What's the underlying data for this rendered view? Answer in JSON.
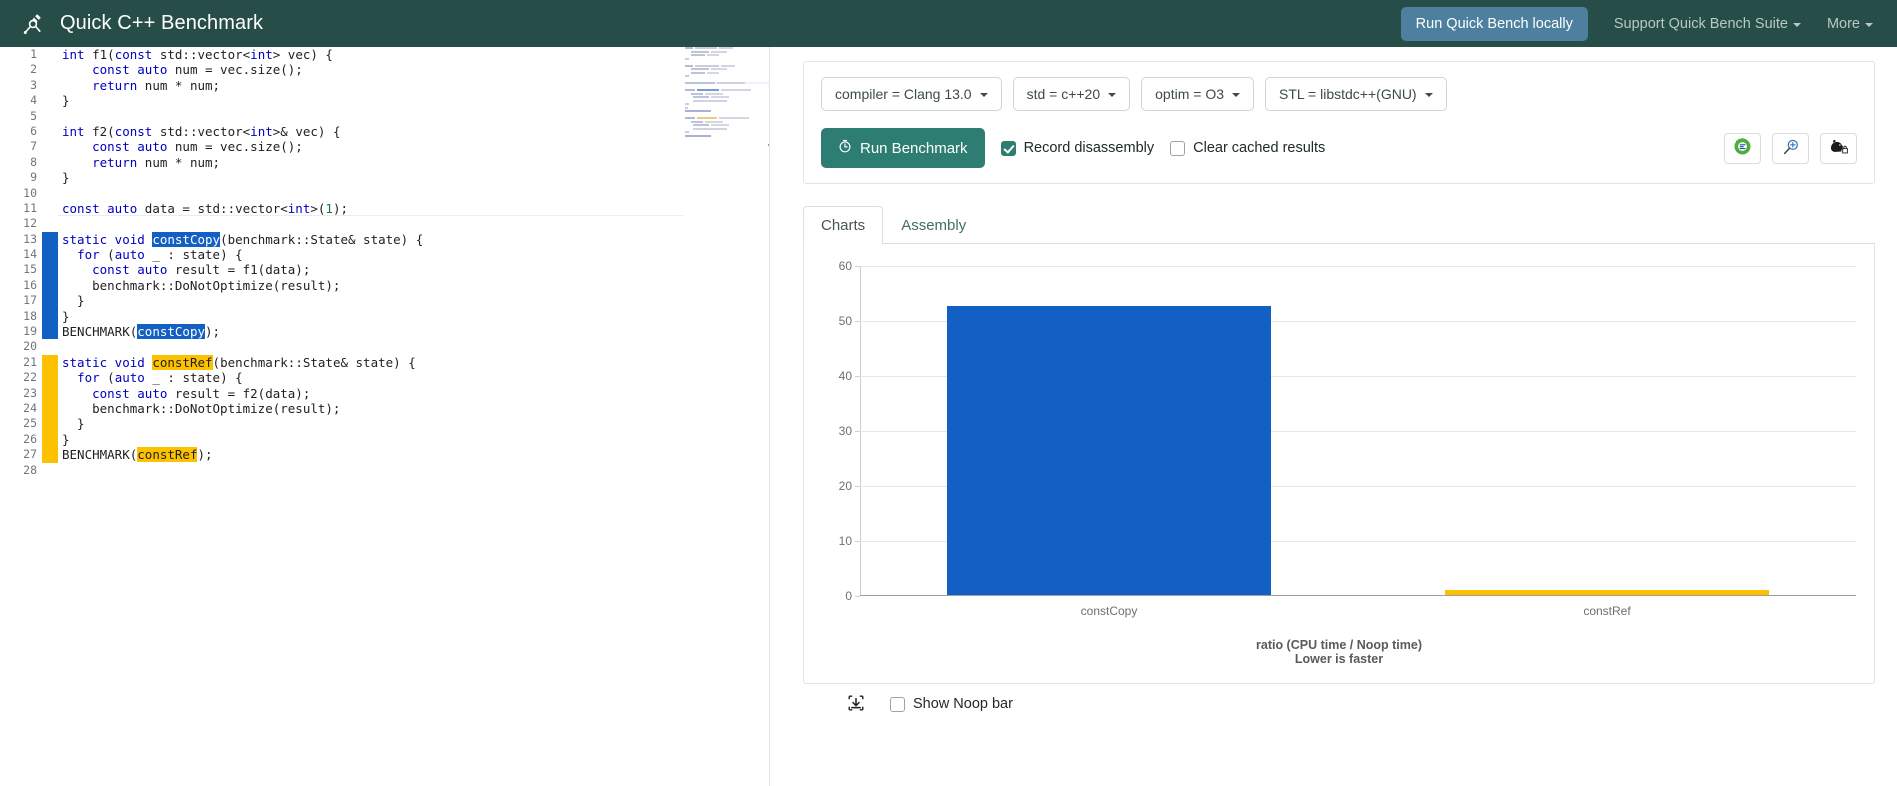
{
  "header": {
    "brand_title": "Quick C++ Benchmark",
    "brand_icon": "microscope-icon",
    "run_locally_label": "Run Quick Bench locally",
    "support_label": "Support Quick Bench Suite",
    "more_label": "More",
    "bg_color": "#264d48",
    "run_locally_color": "#4d7f9e"
  },
  "editor": {
    "lines": [
      {
        "n": "1",
        "mark": "none",
        "current": false,
        "tokens": [
          {
            "t": "int ",
            "c": "k"
          },
          {
            "t": "f1(",
            "c": ""
          },
          {
            "t": "const",
            "c": "k"
          },
          {
            "t": " std::vector<",
            "c": ""
          },
          {
            "t": "int",
            "c": "k"
          },
          {
            "t": "> vec) {",
            "c": ""
          }
        ]
      },
      {
        "n": "2",
        "mark": "none",
        "current": false,
        "tokens": [
          {
            "t": "    ",
            "c": ""
          },
          {
            "t": "const auto",
            "c": "k"
          },
          {
            "t": " num = vec.size();",
            "c": ""
          }
        ]
      },
      {
        "n": "3",
        "mark": "none",
        "current": false,
        "tokens": [
          {
            "t": "    ",
            "c": ""
          },
          {
            "t": "return",
            "c": "k"
          },
          {
            "t": " num * num;",
            "c": ""
          }
        ]
      },
      {
        "n": "4",
        "mark": "none",
        "current": false,
        "tokens": [
          {
            "t": "}",
            "c": ""
          }
        ]
      },
      {
        "n": "5",
        "mark": "none",
        "current": false,
        "tokens": [
          {
            "t": "",
            "c": ""
          }
        ]
      },
      {
        "n": "6",
        "mark": "none",
        "current": false,
        "tokens": [
          {
            "t": "int ",
            "c": "k"
          },
          {
            "t": "f2(",
            "c": ""
          },
          {
            "t": "const",
            "c": "k"
          },
          {
            "t": " std::vector<",
            "c": ""
          },
          {
            "t": "int",
            "c": "k"
          },
          {
            "t": ">& vec) {",
            "c": ""
          }
        ]
      },
      {
        "n": "7",
        "mark": "none",
        "current": false,
        "tokens": [
          {
            "t": "    ",
            "c": ""
          },
          {
            "t": "const auto",
            "c": "k"
          },
          {
            "t": " num = vec.size();",
            "c": ""
          }
        ]
      },
      {
        "n": "8",
        "mark": "none",
        "current": false,
        "tokens": [
          {
            "t": "    ",
            "c": ""
          },
          {
            "t": "return",
            "c": "k"
          },
          {
            "t": " num * num;",
            "c": ""
          }
        ]
      },
      {
        "n": "9",
        "mark": "none",
        "current": false,
        "tokens": [
          {
            "t": "}",
            "c": ""
          }
        ]
      },
      {
        "n": "10",
        "mark": "none",
        "current": false,
        "tokens": [
          {
            "t": "",
            "c": ""
          }
        ]
      },
      {
        "n": "11",
        "mark": "none",
        "current": true,
        "tokens": [
          {
            "t": "const auto",
            "c": "k"
          },
          {
            "t": " data = std::vector<",
            "c": ""
          },
          {
            "t": "int",
            "c": "k"
          },
          {
            "t": ">(",
            "c": ""
          },
          {
            "t": "1",
            "c": "num"
          },
          {
            "t": ");",
            "c": ""
          }
        ]
      },
      {
        "n": "12",
        "mark": "none",
        "current": false,
        "tokens": [
          {
            "t": "",
            "c": ""
          }
        ]
      },
      {
        "n": "13",
        "mark": "blue",
        "current": false,
        "tokens": [
          {
            "t": "static void",
            "c": "k"
          },
          {
            "t": " ",
            "c": ""
          },
          {
            "t": "constCopy",
            "c": "sel-blue"
          },
          {
            "t": "(benchmark::State& state) {",
            "c": ""
          }
        ]
      },
      {
        "n": "14",
        "mark": "blue",
        "current": false,
        "tokens": [
          {
            "t": "  ",
            "c": ""
          },
          {
            "t": "for",
            "c": "k"
          },
          {
            "t": " (",
            "c": ""
          },
          {
            "t": "auto",
            "c": "k"
          },
          {
            "t": " _ : state) {",
            "c": ""
          }
        ]
      },
      {
        "n": "15",
        "mark": "blue",
        "current": false,
        "tokens": [
          {
            "t": "    ",
            "c": ""
          },
          {
            "t": "const auto",
            "c": "k"
          },
          {
            "t": " result = f1(data);",
            "c": ""
          }
        ]
      },
      {
        "n": "16",
        "mark": "blue",
        "current": false,
        "tokens": [
          {
            "t": "    benchmark::DoNotOptimize(result);",
            "c": ""
          }
        ]
      },
      {
        "n": "17",
        "mark": "blue",
        "current": false,
        "tokens": [
          {
            "t": "  }",
            "c": ""
          }
        ]
      },
      {
        "n": "18",
        "mark": "blue",
        "current": false,
        "tokens": [
          {
            "t": "}",
            "c": ""
          }
        ]
      },
      {
        "n": "19",
        "mark": "blue",
        "current": false,
        "tokens": [
          {
            "t": "BENCHMARK(",
            "c": ""
          },
          {
            "t": "constCopy",
            "c": "sel-blue"
          },
          {
            "t": ");",
            "c": ""
          }
        ]
      },
      {
        "n": "20",
        "mark": "none",
        "current": false,
        "tokens": [
          {
            "t": "",
            "c": ""
          }
        ]
      },
      {
        "n": "21",
        "mark": "yellow",
        "current": false,
        "tokens": [
          {
            "t": "static void",
            "c": "k"
          },
          {
            "t": " ",
            "c": ""
          },
          {
            "t": "constRef",
            "c": "sel-yellow"
          },
          {
            "t": "(benchmark::State& state) {",
            "c": ""
          }
        ]
      },
      {
        "n": "22",
        "mark": "yellow",
        "current": false,
        "tokens": [
          {
            "t": "  ",
            "c": ""
          },
          {
            "t": "for",
            "c": "k"
          },
          {
            "t": " (",
            "c": ""
          },
          {
            "t": "auto",
            "c": "k"
          },
          {
            "t": " _ : state) {",
            "c": ""
          }
        ]
      },
      {
        "n": "23",
        "mark": "yellow",
        "current": false,
        "tokens": [
          {
            "t": "    ",
            "c": ""
          },
          {
            "t": "const auto",
            "c": "k"
          },
          {
            "t": " result = f2(data);",
            "c": ""
          }
        ]
      },
      {
        "n": "24",
        "mark": "yellow",
        "current": false,
        "tokens": [
          {
            "t": "    benchmark::DoNotOptimize(result);",
            "c": ""
          }
        ]
      },
      {
        "n": "25",
        "mark": "yellow",
        "current": false,
        "tokens": [
          {
            "t": "  }",
            "c": ""
          }
        ]
      },
      {
        "n": "26",
        "mark": "yellow",
        "current": false,
        "tokens": [
          {
            "t": "}",
            "c": ""
          }
        ]
      },
      {
        "n": "27",
        "mark": "yellow",
        "current": false,
        "tokens": [
          {
            "t": "BENCHMARK(",
            "c": ""
          },
          {
            "t": "constRef",
            "c": "sel-yellow"
          },
          {
            "t": ");",
            "c": ""
          }
        ]
      },
      {
        "n": "28",
        "mark": "none",
        "current": false,
        "tokens": [
          {
            "t": "",
            "c": ""
          }
        ]
      }
    ],
    "selection_blue_color": "#1260c4",
    "selection_yellow_color": "#fcc200"
  },
  "options": {
    "compiler": "compiler = Clang 13.0",
    "std": "std = c++20",
    "optim": "optim = O3",
    "stl": "STL = libstdc++(GNU)"
  },
  "actions": {
    "run_label": "Run Benchmark",
    "run_icon": "stopwatch-icon",
    "record_disassembly_label": "Record disassembly",
    "record_disassembly_checked": true,
    "clear_cached_label": "Clear cached results",
    "clear_cached_checked": false,
    "icon_buttons": [
      {
        "name": "compiler-explorer-icon"
      },
      {
        "name": "magnifier-plus-icon"
      },
      {
        "name": "build-bench-icon"
      }
    ]
  },
  "tabs": [
    {
      "label": "Charts",
      "active": true
    },
    {
      "label": "Assembly",
      "active": false
    }
  ],
  "chart_data": {
    "type": "bar",
    "categories": [
      "constCopy",
      "constRef"
    ],
    "values": [
      52.5,
      1.0
    ],
    "colors": [
      "#1260c4",
      "#fcc200"
    ],
    "title": "",
    "xlabel": "ratio (CPU time / Noop time)",
    "sublabel": "Lower is faster",
    "ylabel": "",
    "ylim": [
      0,
      60
    ],
    "yticks": [
      0,
      10,
      20,
      30,
      40,
      50,
      60
    ],
    "grid": true,
    "legend": "none"
  },
  "chart_footer": {
    "download_icon": "download-icon",
    "show_noop_label": "Show Noop bar",
    "show_noop_checked": false
  }
}
